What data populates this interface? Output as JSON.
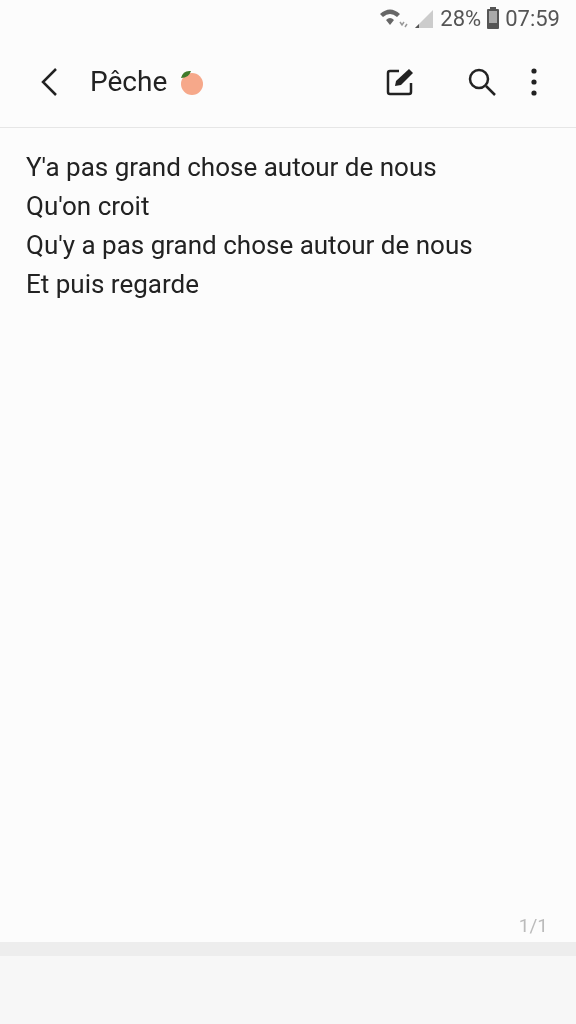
{
  "status_bar": {
    "battery": "28%",
    "time": "07:59"
  },
  "header": {
    "title": "Pêche"
  },
  "note": {
    "lines": [
      "Y'a pas grand chose autour de nous",
      "Qu'on croit",
      "Qu'y a pas grand chose autour de nous",
      "Et puis regarde"
    ]
  },
  "page_indicator": "1/1"
}
